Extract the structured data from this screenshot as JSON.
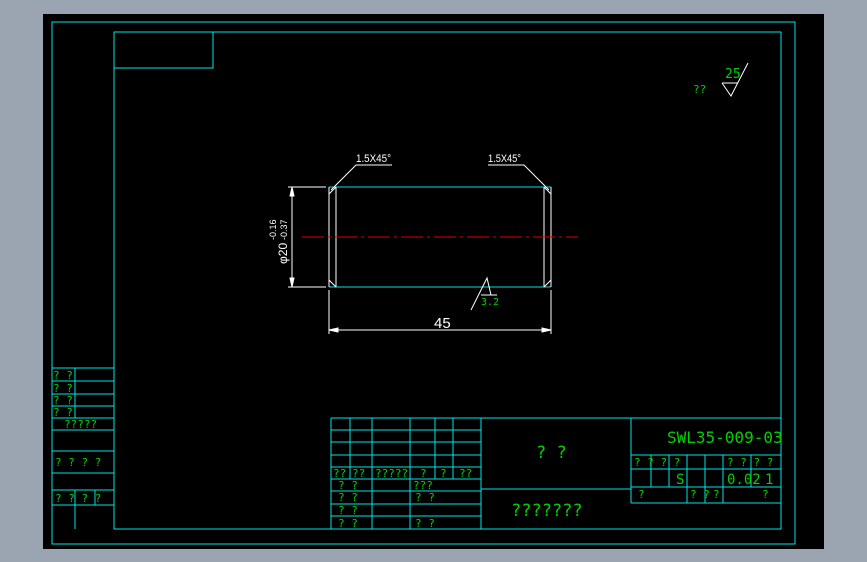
{
  "colors": {
    "background": "#9aa5b1",
    "canvas": "#000000",
    "frame": "#00e5e5",
    "text_green": "#00d000",
    "white": "#ffffff",
    "centerline": "#e00000"
  },
  "roughness": {
    "general_prefix": "??",
    "general_value": "25",
    "local_value": "3.2"
  },
  "chamfers": {
    "left": "1.5X45°",
    "right": "1.5X45°"
  },
  "dimensions": {
    "diameter": "φ20",
    "tol_upper": "-0.16",
    "tol_lower": "-0.37",
    "length": "45"
  },
  "left_panel": {
    "rows": [
      "? ?",
      "? ?",
      "? ?",
      "? ?"
    ],
    "label_a": "?????",
    "label_b": "? ? ? ?",
    "label_c": "? ? ? ?"
  },
  "title_block": {
    "drawing_no": "SWL35-009-03",
    "material": "? ?",
    "company": "???????",
    "header_row": [
      "??",
      "??",
      "?????",
      "?",
      "?",
      "??"
    ],
    "sign_rows": [
      {
        "a": "? ?",
        "b": "???"
      },
      {
        "a": "? ?",
        "b": "? ?"
      },
      {
        "a": "? ?",
        "b": ""
      },
      {
        "a": "? ?",
        "b": "? ?"
      }
    ],
    "stage_label": "? ? ? ?",
    "weight_label": "? ? ? ?",
    "stage_mark": "S",
    "weight": "0.02",
    "scale": "1",
    "sheet_row": [
      "?",
      "? ?",
      "?",
      "?"
    ]
  }
}
